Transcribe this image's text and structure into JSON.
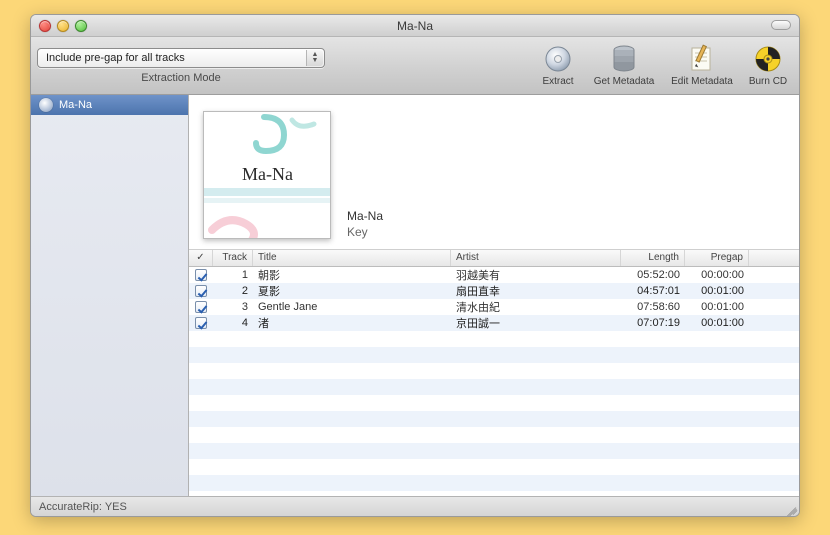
{
  "window": {
    "title": "Ma-Na"
  },
  "toolbar": {
    "popup": {
      "value": "Include pre-gap for all tracks"
    },
    "popup_label": "Extraction Mode",
    "buttons": {
      "extract": "Extract",
      "get_metadata": "Get Metadata",
      "edit_metadata": "Edit Metadata",
      "burn_cd": "Burn CD"
    }
  },
  "sidebar": {
    "items": [
      {
        "label": "Ma-Na"
      }
    ]
  },
  "album": {
    "title": "Ma-Na",
    "artist": "Key",
    "cover_text": "Ma-Na"
  },
  "columns": {
    "check": "✓",
    "track": "Track",
    "title": "Title",
    "artist": "Artist",
    "length": "Length",
    "pregap": "Pregap"
  },
  "tracks": [
    {
      "n": 1,
      "title": "朝影",
      "artist": "羽越美有",
      "length": "05:52:00",
      "pregap": "00:00:00"
    },
    {
      "n": 2,
      "title": "夏影",
      "artist": "扇田直幸",
      "length": "04:57:01",
      "pregap": "00:01:00"
    },
    {
      "n": 3,
      "title": "Gentle Jane",
      "artist": "清水由紀",
      "length": "07:58:60",
      "pregap": "00:01:00"
    },
    {
      "n": 4,
      "title": "渚",
      "artist": "京田誠一",
      "length": "07:07:19",
      "pregap": "00:01:00"
    }
  ],
  "status": {
    "accurate_rip": "AccurateRip:  YES"
  }
}
